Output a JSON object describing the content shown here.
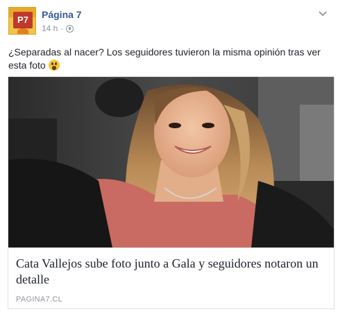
{
  "post": {
    "page_name": "Página 7",
    "time": "14 h",
    "separator": "·",
    "privacy_icon": "globe-icon",
    "menu_icon": "chevron-down-icon",
    "text": "¿Separadas al nacer? Los seguidores tuvieron la misma opinión tras ver esta foto",
    "emoji": "surprised-face-emoji"
  },
  "avatar": {
    "logo_text": "P7",
    "colors": {
      "bg": "#f0c54a",
      "logo": "#c0392b"
    }
  },
  "link": {
    "title": "Cata Vallejos sube foto junto a Gala y seguidores notaron un detalle",
    "domain": "PAGINA7.CL",
    "image": "selfie-photo-woman-in-car"
  },
  "colors": {
    "page_name": "#365899",
    "meta": "#90949c",
    "text": "#1d2129",
    "border": "#dddfe2"
  }
}
